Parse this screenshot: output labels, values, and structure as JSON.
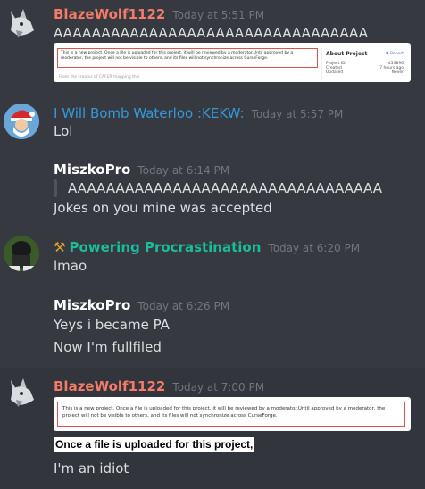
{
  "messages": [
    {
      "author": "BlazeWolf1122",
      "author_color": "#f47b67",
      "timestamp": "Today at 5:51 PM",
      "lines": [
        "AAAAAAAAAAAAAAAAAAAAAAAAAAAAAAAAA"
      ],
      "embed": {
        "notice": "This is a new project. Once a file is uploaded for this project, it will be reviewed by a moderator.Until approved by a moderator, the project will not be visible to others, and its files will not synchronize across CurseForge.",
        "about_title": "About Project",
        "report_label": "Report",
        "fields": [
          {
            "label": "Project ID",
            "value": "433896"
          },
          {
            "label": "Created",
            "value": "7 hours ago"
          },
          {
            "label": "Updated",
            "value": "Never"
          }
        ],
        "footer_text": "From the creator of CAFER mapping this"
      }
    },
    {
      "author": "I Will Bomb Waterloo :KEKW:",
      "author_color": "#3498db",
      "timestamp": "Today at 5:57 PM",
      "lines": [
        "Lol"
      ]
    },
    {
      "author": "MiszkoPro",
      "author_color": "#ffffff",
      "timestamp": "Today at 6:14 PM",
      "quote": "AAAAAAAAAAAAAAAAAAAAAAAAAAAAAAAAA",
      "lines": [
        "Jokes on you mine was accepted"
      ]
    },
    {
      "author": "Powering Procrastination",
      "author_color": "#1abc9c",
      "timestamp": "Today at 6:20 PM",
      "role_icon": "hammer-pick-emoji",
      "lines": [
        "lmao"
      ]
    },
    {
      "author": "MiszkoPro",
      "author_color": "#ffffff",
      "timestamp": "Today at 6:26 PM",
      "lines": [
        "Yeys i became PA",
        "Now I'm fullfiled"
      ]
    },
    {
      "author": "BlazeWolf1122",
      "author_color": "#f47b67",
      "timestamp": "Today at 7:00 PM",
      "embed2": {
        "notice": "This is a new project. Once a file is uploaded for this project, it will be reviewed by a moderator.Until approved by a moderator, the project will not be visible to others, and its files will not synchronize across CurseForge."
      },
      "highlight": "Once a file is uploaded for this project,",
      "lines": [
        "I'm an idiot"
      ]
    }
  ]
}
